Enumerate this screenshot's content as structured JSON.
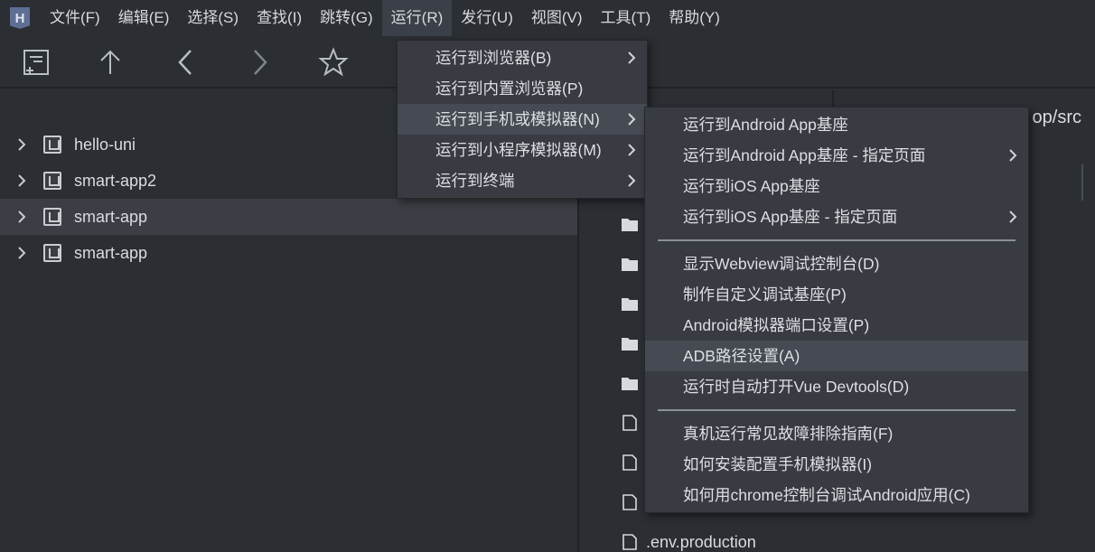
{
  "menubar": {
    "logo": "H",
    "items": [
      {
        "label": "文件(F)",
        "active": false
      },
      {
        "label": "编辑(E)",
        "active": false
      },
      {
        "label": "选择(S)",
        "active": false
      },
      {
        "label": "查找(I)",
        "active": false
      },
      {
        "label": "跳转(G)",
        "active": false
      },
      {
        "label": "运行(R)",
        "active": true
      },
      {
        "label": "发行(U)",
        "active": false
      },
      {
        "label": "视图(V)",
        "active": false
      },
      {
        "label": "工具(T)",
        "active": false
      },
      {
        "label": "帮助(Y)",
        "active": false
      }
    ]
  },
  "toolbar": {
    "icons": [
      "new-project-icon",
      "arrow-up-icon",
      "back-chevron-icon",
      "forward-chevron-icon",
      "star-icon"
    ]
  },
  "project_tree": {
    "items": [
      {
        "label": "hello-uni",
        "selected": false
      },
      {
        "label": "smart-app2",
        "selected": false
      },
      {
        "label": "smart-app",
        "selected": true
      },
      {
        "label": "smart-app",
        "selected": false
      }
    ]
  },
  "file_panel": {
    "path_tab": "op/src",
    "files": [
      {
        "type": "folder",
        "label": ""
      },
      {
        "type": "folder",
        "label": ""
      },
      {
        "type": "folder",
        "label": ""
      },
      {
        "type": "folder",
        "label": ""
      },
      {
        "type": "folder",
        "label": ""
      },
      {
        "type": "file",
        "label": ""
      },
      {
        "type": "file",
        "label": ""
      },
      {
        "type": "file",
        "label": ""
      },
      {
        "type": "file",
        "label": ".env.production"
      }
    ]
  },
  "run_menu": {
    "items": [
      {
        "label": "运行到浏览器(B)",
        "submenu": true,
        "hover": false
      },
      {
        "label": "运行到内置浏览器(P)",
        "submenu": false,
        "hover": false
      },
      {
        "label": "运行到手机或模拟器(N)",
        "submenu": true,
        "hover": true
      },
      {
        "label": "运行到小程序模拟器(M)",
        "submenu": true,
        "hover": false
      },
      {
        "label": "运行到终端",
        "submenu": true,
        "hover": false
      }
    ]
  },
  "device_submenu": {
    "group1": [
      {
        "label": "运行到Android App基座",
        "submenu": false
      },
      {
        "label": "运行到Android App基座 - 指定页面",
        "submenu": true
      },
      {
        "label": "运行到iOS App基座",
        "submenu": false
      },
      {
        "label": "运行到iOS App基座 - 指定页面",
        "submenu": true
      }
    ],
    "group2": [
      {
        "label": "显示Webview调试控制台(D)",
        "hover": false
      },
      {
        "label": "制作自定义调试基座(P)",
        "hover": false
      },
      {
        "label": "Android模拟器端口设置(P)",
        "hover": false
      },
      {
        "label": "ADB路径设置(A)",
        "hover": true
      },
      {
        "label": "运行时自动打开Vue Devtools(D)",
        "hover": false
      }
    ],
    "group3": [
      {
        "label": "真机运行常见故障排除指南(F)"
      },
      {
        "label": "如何安装配置手机模拟器(I)"
      },
      {
        "label": "如何用chrome控制台调试Android应用(C)"
      }
    ]
  },
  "colors": {
    "background": "#2b2e33",
    "menu_bg": "#383b41",
    "hover_bg": "#464a52",
    "selected_row": "#3b3e44",
    "text": "#d9dce0"
  }
}
